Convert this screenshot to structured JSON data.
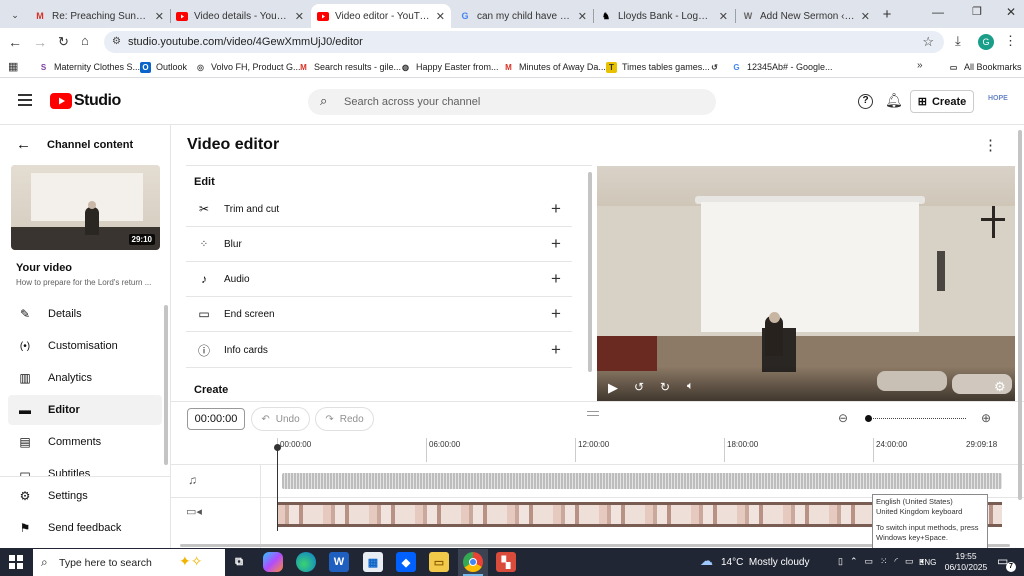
{
  "browser": {
    "tabs": [
      {
        "title": "Re: Preaching Sunday 5/10",
        "favicon": "gmail-icon"
      },
      {
        "title": "Video details - YouTube Stu",
        "favicon": "youtube-icon"
      },
      {
        "title": "Video editor - YouTube Stu",
        "favicon": "youtube-icon",
        "active": true
      },
      {
        "title": "can my child have smart st",
        "favicon": "google-icon"
      },
      {
        "title": "Lloyds Bank - Logged Off",
        "favicon": "lloyds-icon"
      },
      {
        "title": "Add New Sermon ‹ Hope C",
        "favicon": "wordpress-icon"
      }
    ],
    "url": "studio.youtube.com/video/4GewXmmUjJ0/editor",
    "profile_initial": "G",
    "bookmarks": [
      {
        "label": "Maternity Clothes S...",
        "icon": "s-icon"
      },
      {
        "label": "Outlook",
        "icon": "outlook-icon"
      },
      {
        "label": "Volvo FH, Product G...",
        "icon": "volvo-icon"
      },
      {
        "label": "Search results - gile...",
        "icon": "gmail-icon"
      },
      {
        "label": "Happy Easter from...",
        "icon": "globe-icon"
      },
      {
        "label": "Minutes of Away Da...",
        "icon": "gmail-icon"
      },
      {
        "label": "Times tables games...",
        "icon": "tt-icon"
      },
      {
        "label": "",
        "icon": "history-icon"
      },
      {
        "label": "12345Ab# - Google...",
        "icon": "google-icon"
      }
    ],
    "all_bookmarks": "All Bookmarks"
  },
  "studio": {
    "logo_text": "Studio",
    "search_placeholder": "Search across your channel",
    "create_label": "Create"
  },
  "sidebar": {
    "back_label": "Channel content",
    "thumb_duration": "29:10",
    "your_video_label": "Your video",
    "video_title": "How to prepare for the Lord's return ...",
    "items": [
      {
        "label": "Details",
        "icon": "pencil-icon"
      },
      {
        "label": "Customisation",
        "icon": "broadcast-icon"
      },
      {
        "label": "Analytics",
        "icon": "analytics-icon"
      },
      {
        "label": "Editor",
        "icon": "clapperboard-icon",
        "selected": true
      },
      {
        "label": "Comments",
        "icon": "comments-icon"
      },
      {
        "label": "Subtitles",
        "icon": "subtitles-icon"
      }
    ],
    "settings_label": "Settings",
    "feedback_label": "Send feedback"
  },
  "editor": {
    "title": "Video editor",
    "edit_heading": "Edit",
    "tools": [
      {
        "label": "Trim and cut",
        "icon": "scissors-icon"
      },
      {
        "label": "Blur",
        "icon": "blur-icon"
      },
      {
        "label": "Audio",
        "icon": "music-note-icon"
      },
      {
        "label": "End screen",
        "icon": "end-screen-icon"
      },
      {
        "label": "Info cards",
        "icon": "info-icon"
      }
    ],
    "create_heading": "Create",
    "time_value": "00:00:00",
    "undo_label": "Undo",
    "redo_label": "Redo",
    "timeline_ticks": [
      "00:00:00",
      "06:00:00",
      "12:00:00",
      "18:00:00",
      "24:00:00",
      "29:09:18"
    ]
  },
  "ime_tooltip": {
    "line1": "English (United States)",
    "line2": "United Kingdom keyboard",
    "line3": "To switch input methods, press Windows key+Space."
  },
  "taskbar": {
    "search_placeholder": "Type here to search",
    "weather": "14°C  Mostly cloudy",
    "language": "ENG",
    "time": "19:55",
    "date": "06/10/2025",
    "notifications": "7"
  },
  "colors": {
    "youtube_red": "#ff0000",
    "taskbar": "#202634",
    "chrome_tabstrip": "#dfe3eb"
  }
}
